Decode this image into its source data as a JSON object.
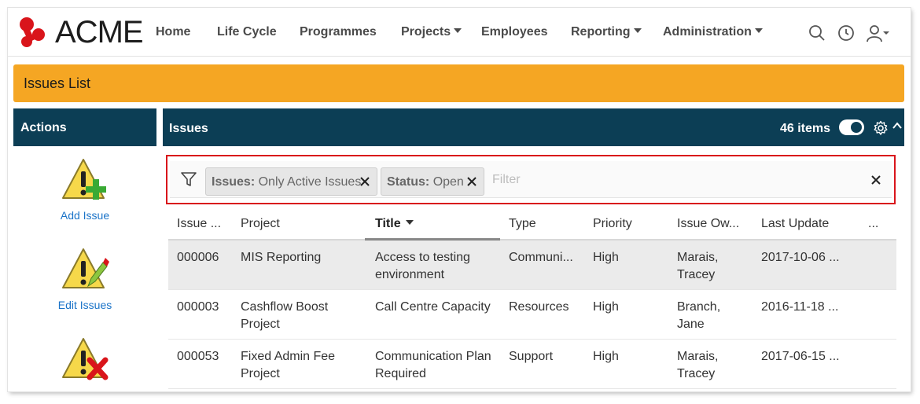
{
  "brand": {
    "name": "ACME",
    "logo_color": "#d9151b"
  },
  "nav": {
    "items": [
      {
        "label": "Home",
        "has_caret": false
      },
      {
        "label": "Life Cycle",
        "has_caret": false
      },
      {
        "label": "Programmes",
        "has_caret": false
      },
      {
        "label": "Projects",
        "has_caret": true
      },
      {
        "label": "Employees",
        "has_caret": false
      },
      {
        "label": "Reporting",
        "has_caret": true
      },
      {
        "label": "Administration",
        "has_caret": true
      }
    ],
    "icons": [
      "search-icon",
      "clock-icon",
      "user-menu-icon"
    ]
  },
  "page": {
    "title": "Issues List",
    "accent": "#f5a623",
    "header_color": "#0c3e55"
  },
  "actions": {
    "title": "Actions",
    "items": [
      {
        "label": "Add Issue",
        "icon": "warning-add-icon"
      },
      {
        "label": "Edit Issues",
        "icon": "warning-edit-icon"
      },
      {
        "label": "",
        "icon": "warning-delete-icon"
      }
    ]
  },
  "issues": {
    "title": "Issues",
    "count_label": "46 items",
    "filter": {
      "chips": [
        {
          "key": "Issues:",
          "value": "Only Active Issues"
        },
        {
          "key": "Status:",
          "value": "Open"
        }
      ],
      "placeholder": "Filter"
    },
    "columns": [
      "Issue ...",
      "Project",
      "Title",
      "Type",
      "Priority",
      "Issue Ow...",
      "Last Update",
      "..."
    ],
    "sorted_column": "Title",
    "rows": [
      {
        "id": "000006",
        "project": [
          "MIS Reporting"
        ],
        "title": [
          "Access to testing",
          "environment"
        ],
        "type": "Communi...",
        "priority": "High",
        "owner": [
          "Marais,",
          "Tracey"
        ],
        "updated": "2017-10-06 ...",
        "selected": true
      },
      {
        "id": "000003",
        "project": [
          "Cashflow Boost",
          "Project"
        ],
        "title": [
          "Call Centre Capacity"
        ],
        "type": "Resources",
        "priority": "High",
        "owner": [
          "Branch,",
          "Jane"
        ],
        "updated": "2016-11-18 ...",
        "selected": false
      },
      {
        "id": "000053",
        "project": [
          "Fixed Admin Fee",
          "Project"
        ],
        "title": [
          "Communication Plan",
          "Required"
        ],
        "type": "Support",
        "priority": "High",
        "owner": [
          "Marais,",
          "Tracey"
        ],
        "updated": "2017-06-15 ...",
        "selected": false
      }
    ]
  }
}
